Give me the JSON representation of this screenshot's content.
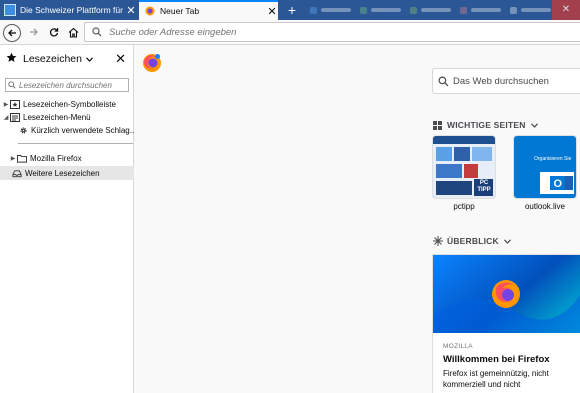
{
  "tabs": [
    {
      "title": "Die Schweizer Plattform für Computer",
      "active": false
    },
    {
      "title": "Neuer Tab",
      "active": true
    }
  ],
  "tab_close_glyph": "✕",
  "new_tab_glyph": "+",
  "urlbar": {
    "placeholder": "Suche oder Adresse eingeben"
  },
  "sidebar": {
    "title": "Lesezeichen",
    "close_glyph": "✕",
    "search_placeholder": "Lesezeichen durchsuchen",
    "items": [
      {
        "label": "Lesezeichen-Symbolleiste",
        "icon": "toolbar-icon"
      },
      {
        "label": "Lesezeichen-Menü",
        "icon": "menu-icon"
      },
      {
        "label": "Kürzlich verwendete Schlag...",
        "icon": "gear-icon"
      },
      {
        "label": "Mozilla Firefox",
        "icon": "folder-icon"
      },
      {
        "label": "Weitere Lesezeichen",
        "icon": "other-bookmarks-icon"
      }
    ]
  },
  "content": {
    "search_placeholder": "Das Web durchsuchen",
    "top_sites_heading": "WICHTIGE SEITEN",
    "top_sites": [
      {
        "label": "pctipp"
      },
      {
        "label": "outlook.live"
      }
    ],
    "tile1_badge": "PC TIPP",
    "tile2_text": "Organisieren Sie",
    "highlights_heading": "ÜBERBLICK",
    "card": {
      "source": "MOZILLA",
      "title": "Willkommen bei Firefox",
      "description": "Firefox ist gemeinnützig, nicht kommerziell und nicht"
    }
  },
  "colors": {
    "tab_strip": "#2b5797",
    "accent": "#0a84ff",
    "sidebar_selected": "#e6e6e6"
  }
}
